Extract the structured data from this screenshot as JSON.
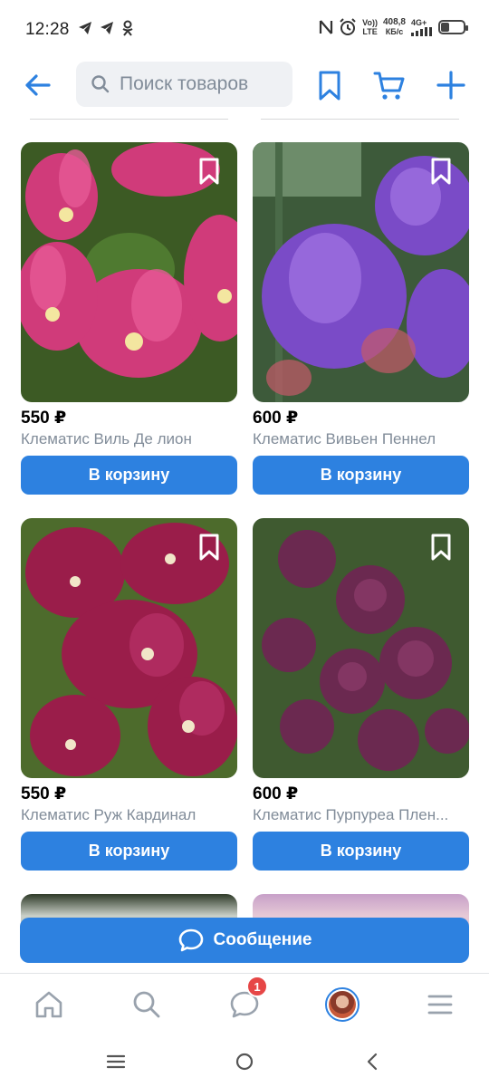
{
  "status": {
    "time": "12:28",
    "data_speed": "408,8",
    "data_unit": "КБ/с",
    "volte_top": "Vo))",
    "volte_bottom": "LTE",
    "network": "4G+"
  },
  "header": {
    "search_placeholder": "Поиск товаров"
  },
  "products": [
    {
      "price": "550 ₽",
      "name": "Клематис Виль Де лион",
      "button": "В корзину"
    },
    {
      "price": "600 ₽",
      "name": "Клематис Вивьен Пеннел",
      "button": "В корзину"
    },
    {
      "price": "550 ₽",
      "name": "Клематис Руж Кардинал",
      "button": "В корзину"
    },
    {
      "price": "600 ₽",
      "name": "Клематис Пурпуреа Плен...",
      "button": "В корзину"
    }
  ],
  "message_button": "Сообщение",
  "tabbar": {
    "messages_badge": "1"
  },
  "colors": {
    "accent": "#2d81e0",
    "badge": "#e64646",
    "secondary_text": "#818c99"
  },
  "icons": [
    "back-arrow-icon",
    "search-icon",
    "bookmark-icon",
    "cart-icon",
    "plus-icon",
    "chat-icon",
    "home-icon",
    "menu-icon"
  ]
}
